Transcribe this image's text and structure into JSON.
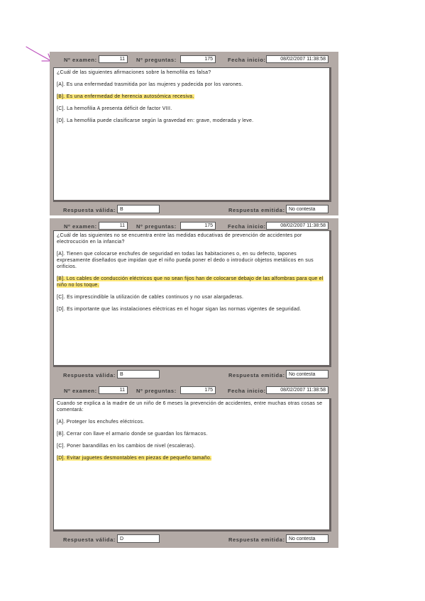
{
  "labels": {
    "examen": "Nº examen:",
    "preguntas": "Nº preguntas:",
    "fecha": "Fecha inicio:",
    "valida": "Respuesta válida:",
    "emitida": "Respuesta emitida:"
  },
  "questions": [
    {
      "examen": "11",
      "preguntas": "175",
      "fecha": "08/02/2007 11:38:58",
      "stem": "¿Cuál de las siguientes afirmaciones sobre la hemofilia es falsa?",
      "options": [
        {
          "text": "[A]. Es una enfermedad trasmitida por las mujeres y padecida por los varones.",
          "highlight": false
        },
        {
          "text": "[B]. Es una enfermedad de herencia autosómica recesiva.",
          "highlight": true
        },
        {
          "text": "[C]. La hemofilia A presenta déficit de factor VIII.",
          "highlight": false
        },
        {
          "text": "[D]. La hemofilia puede clasificarse según la gravedad en: grave, moderada y leve.",
          "highlight": false
        }
      ],
      "valida": "B",
      "emitida": "No contesta"
    },
    {
      "examen": "11",
      "preguntas": "175",
      "fecha": "08/02/2007 11:38:58",
      "stem": "¿Cuál de las siguientes no se encuentra entre las medidas educativas de prevención de accidentes por electrocución en la infancia?",
      "options": [
        {
          "text": "[A]. Tienen que colocarse enchufes de seguridad en todas las habitaciones o, en su defecto, tapones expresamente diseñados que impidan que el niño pueda poner el dedo o introducir objetos metálicos en sus orificios.",
          "highlight": false
        },
        {
          "text": "[B]. Los cables de conducción eléctricos que no sean fijos han de colocarse debajo de las alfombras para que el niño no los toque.",
          "highlight": true
        },
        {
          "text": "[C]. Es imprescindible la utilización de cables continuos y no usar alargaderas.",
          "highlight": false
        },
        {
          "text": "[D]. Es importante que las instalaciones eléctricas en el hogar sigan las normas vigentes de seguridad.",
          "highlight": false
        }
      ],
      "valida": "B",
      "emitida": "No contesta"
    },
    {
      "examen": "11",
      "preguntas": "175",
      "fecha": "08/02/2007 11:38:58",
      "stem": "Cuando se explica a la madre de un niño de 6 meses la prevención de accidentes, entre muchas otras cosas se comentará:",
      "options": [
        {
          "text": "[A]. Proteger los enchufes eléctricos.",
          "highlight": false
        },
        {
          "text": "[B]. Cerrar con llave el armario donde se guardan los fármacos.",
          "highlight": false
        },
        {
          "text": "[C]. Poner barandillas en los cambios de nivel (escaleras).",
          "highlight": false
        },
        {
          "text": "[D]. Evitar juguetes desmontables en piezas de pequeño tamaño.",
          "highlight": true
        }
      ],
      "valida": "D",
      "emitida": "No contesta"
    }
  ],
  "colors": {
    "panel": "#b3aaa6",
    "highlight": "#ffe97a",
    "arrow": "#c058c0"
  },
  "icons": {
    "annotation": "pen-arrow-icon"
  }
}
